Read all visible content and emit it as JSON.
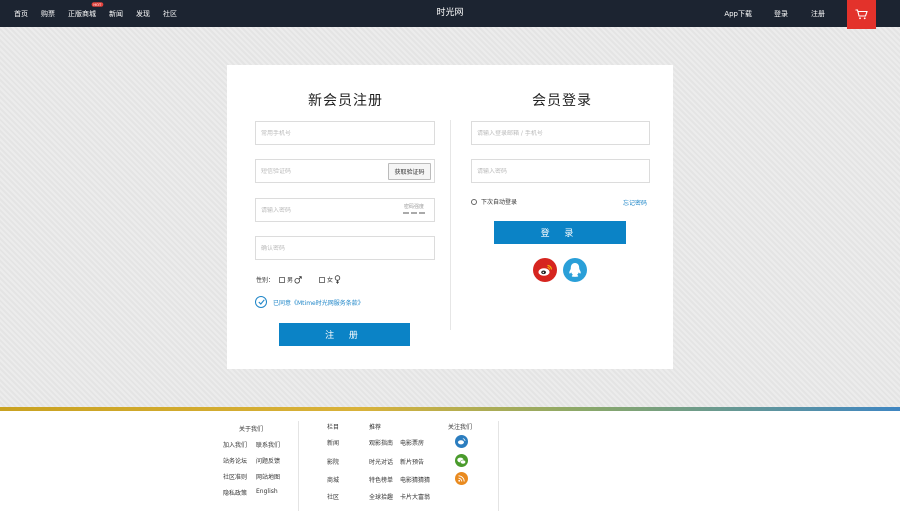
{
  "nav": {
    "items": [
      "首页",
      "购票",
      "正版商城",
      "新闻",
      "发现",
      "社区"
    ],
    "hot_badge": "HOT",
    "site_title": "时光网",
    "app_download": "App下载",
    "login": "登录",
    "register": "注册",
    "cart_icon": "cart-icon"
  },
  "register": {
    "title": "新会员注册",
    "phone_placeholder": "常用手机号",
    "sms_placeholder": "短信验证码",
    "get_code_button": "获取验证码",
    "password_placeholder": "请输入密码",
    "strength_label": "密码强度",
    "confirm_placeholder": "确认密码",
    "gender_label": "性别：",
    "male": "男",
    "female": "女",
    "agree_text": "已同意《Mtime时光网服务条款》",
    "submit": "注 册"
  },
  "login": {
    "title": "会员登录",
    "account_placeholder": "请输入登录邮箱 / 手机号",
    "password_placeholder": "请输入密码",
    "auto_login": "下次自动登录",
    "forgot": "忘记密码",
    "submit": "登 录",
    "social": [
      "weibo-icon",
      "qq-icon"
    ]
  },
  "footer": {
    "about_title": "关于我们",
    "about_links": [
      [
        "加入我们",
        "联系我们"
      ],
      [
        "站务论坛",
        "问题反馈"
      ],
      [
        "社区准则",
        "网站地图"
      ],
      [
        "隐私政策",
        "English"
      ]
    ],
    "column_title": "栏目",
    "columns": [
      "新闻",
      "影院",
      "商城",
      "社区"
    ],
    "recommend_title": "推荐",
    "recommend": [
      [
        "观影指南",
        "电影票房"
      ],
      [
        "时光对话",
        "新片预告"
      ],
      [
        "特色榜单",
        "电影猜猜猜"
      ],
      [
        "全球拾趣",
        "卡片大富翁"
      ]
    ],
    "follow_title": "关注我们",
    "follow_icons": [
      "weibo-icon",
      "wechat-icon",
      "rss-icon"
    ],
    "colors": {
      "weibo": "#2b7dbf",
      "wechat": "#4a9b2c",
      "rss": "#e98a1f"
    }
  },
  "colors": {
    "accent": "#0b83c6",
    "topbar": "#1c2431",
    "cart": "#e3322b"
  }
}
